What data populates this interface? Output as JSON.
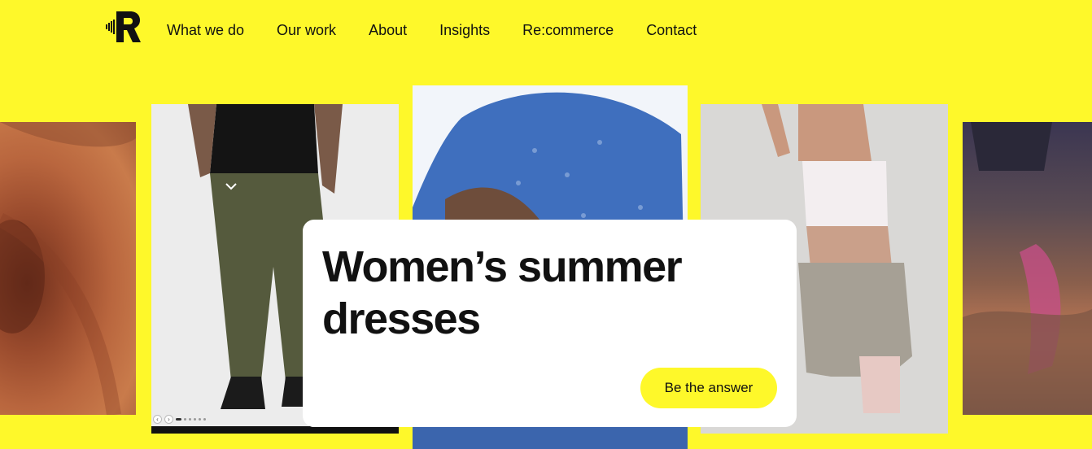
{
  "brand": {
    "logo_icon": "r-logo-icon"
  },
  "nav": {
    "items": [
      {
        "label": "What we do"
      },
      {
        "label": "Our work"
      },
      {
        "label": "About"
      },
      {
        "label": "Insights"
      },
      {
        "label": "Re:commerce"
      },
      {
        "label": "Contact"
      }
    ]
  },
  "hero": {
    "headline": "Women’s summer dresses",
    "cta_label": "Be the answer",
    "accent_color": "#fef82a"
  },
  "gallery": {
    "images": [
      {
        "name": "skin-closeup-image"
      },
      {
        "name": "man-jogger-pants-image"
      },
      {
        "name": "denim-jacket-image"
      },
      {
        "name": "woman-sportswear-image"
      },
      {
        "name": "runner-blur-image"
      }
    ],
    "carousel": {
      "prev_icon": "chevron-left-icon",
      "next_icon": "chevron-right-icon"
    }
  }
}
